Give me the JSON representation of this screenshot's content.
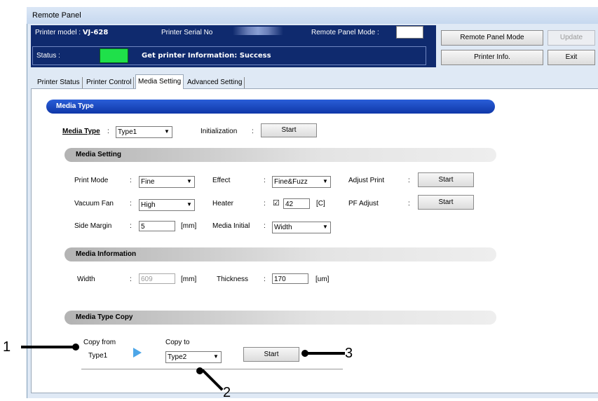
{
  "window": {
    "title": "Remote Panel"
  },
  "header": {
    "model_label": "Printer model :",
    "model_value": "VJ-628",
    "serial_label": "Printer Serial No",
    "mode_label": "Remote Panel Mode :",
    "status_label": "Status :",
    "status_message": "Get printer Information: Success"
  },
  "buttons": {
    "remote_panel_mode": "Remote Panel Mode",
    "update": "Update",
    "printer_info": "Printer Info.",
    "exit": "Exit"
  },
  "tabs": [
    "Printer Status",
    "Printer Control",
    "Media Setting",
    "Advanced Setting"
  ],
  "media_type": {
    "section_title": "Media Type",
    "label": "Media Type",
    "value": "Type1",
    "init_label": "Initialization",
    "init_button": "Start"
  },
  "media_setting": {
    "section_title": "Media Setting",
    "print_mode_label": "Print Mode",
    "print_mode_value": "Fine",
    "effect_label": "Effect",
    "effect_value": "Fine&Fuzz",
    "adjust_print_label": "Adjust Print",
    "adjust_print_button": "Start",
    "vacuum_fan_label": "Vacuum Fan",
    "vacuum_fan_value": "High",
    "heater_label": "Heater",
    "heater_checked": "☑",
    "heater_value": "42",
    "heater_unit": "[C]",
    "pf_adjust_label": "PF Adjust",
    "pf_adjust_button": "Start",
    "side_margin_label": "Side Margin",
    "side_margin_value": "5",
    "side_margin_unit": "[mm]",
    "media_initial_label": "Media Initial",
    "media_initial_value": "Width"
  },
  "media_information": {
    "section_title": "Media Information",
    "width_label": "Width",
    "width_value": "609",
    "width_unit": "[mm]",
    "thickness_label": "Thickness",
    "thickness_value": "170",
    "thickness_unit": "[um]"
  },
  "media_type_copy": {
    "section_title": "Media Type Copy",
    "copy_from_label": "Copy from",
    "copy_from_value": "Type1",
    "copy_to_label": "Copy to",
    "copy_to_value": "Type2",
    "start_button": "Start"
  },
  "callouts": [
    "1",
    "2",
    "3"
  ],
  "colors": {
    "header_bg": "#0f2a6e",
    "status_lamp": "#1fe04a",
    "section_blue": "#0f37a8"
  },
  "separator": ":"
}
